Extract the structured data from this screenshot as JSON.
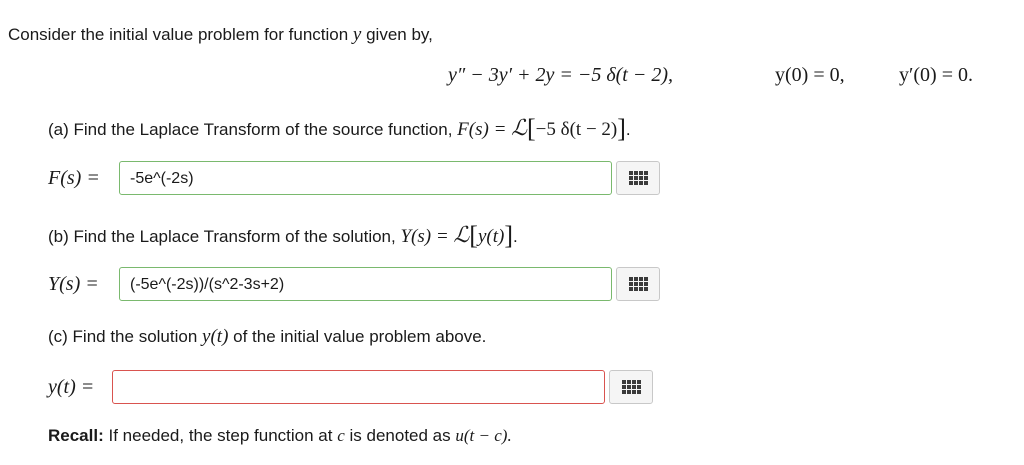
{
  "intro": {
    "text": "Consider the initial value problem for function",
    "var": "y",
    "tail": "given by,"
  },
  "equation": {
    "main": "y″ − 3y′ + 2y = −5 δ(t − 2),",
    "ic1": "y(0) = 0,",
    "ic2": "y′(0) = 0."
  },
  "part_a": {
    "prompt": "(a) Find the Laplace Transform of the source function,",
    "expr": "F(s) =",
    "arg": "−5 δ(t − 2)",
    "label": "F(s) =",
    "answer": "-5e^(-2s)"
  },
  "part_b": {
    "prompt": "(b) Find the Laplace Transform of the solution,",
    "expr": "Y(s) =",
    "arg": "y(t)",
    "label": "Y(s) =",
    "answer": "(-5e^(-2s))/(s^2-3s+2)"
  },
  "part_c": {
    "prompt": "(c) Find the solution",
    "var": "y(t)",
    "tail": "of the initial value problem above.",
    "label": "y(t) =",
    "answer": ""
  },
  "recall": {
    "bold": "Recall:",
    "text": "If needed, the step function at",
    "var": "c",
    "mid": "is denoted as",
    "expr": "u(t − c)."
  },
  "colors": {
    "correct_border": "#7ab96e",
    "incorrect_border": "#d9534f"
  },
  "icons": {
    "equation_editor": "grid-icon"
  }
}
